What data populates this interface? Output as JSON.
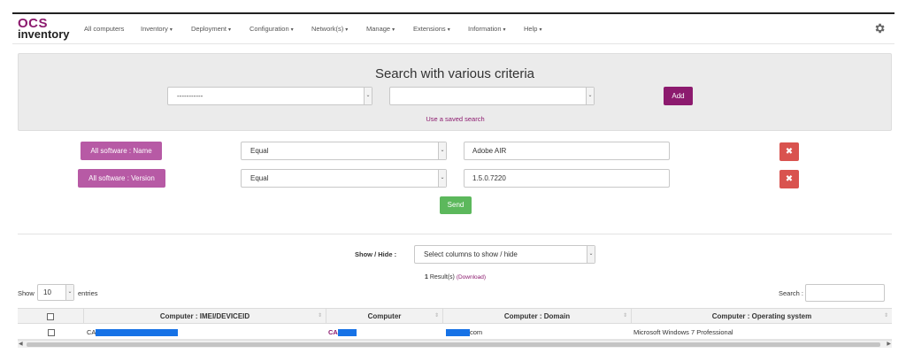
{
  "brand": {
    "logo_top": "OCS",
    "logo_bottom": "inventory",
    "accent": "#8c1a6e"
  },
  "nav": {
    "items": [
      {
        "label": "All computers",
        "dropdown": false
      },
      {
        "label": "Inventory",
        "dropdown": true
      },
      {
        "label": "Deployment",
        "dropdown": true
      },
      {
        "label": "Configuration",
        "dropdown": true
      },
      {
        "label": "Network(s)",
        "dropdown": true
      },
      {
        "label": "Manage",
        "dropdown": true
      },
      {
        "label": "Extensions",
        "dropdown": true
      },
      {
        "label": "Information",
        "dropdown": true
      },
      {
        "label": "Help",
        "dropdown": true
      }
    ],
    "settings_icon": "gear-icon"
  },
  "search": {
    "title": "Search with various criteria",
    "field_select_value": "-----------",
    "second_select_value": "",
    "add_label": "Add",
    "saved_search_link": "Use a saved search"
  },
  "criteria": [
    {
      "label": "All software : Name",
      "operator": "Equal",
      "value": "Adobe AIR"
    },
    {
      "label": "All software : Version",
      "operator": "Equal",
      "value": "1.5.0.7220"
    }
  ],
  "send_label": "Send",
  "showhide": {
    "label": "Show / Hide :",
    "select_value": "Select columns to show / hide"
  },
  "results": {
    "count": "1",
    "label": "Result(s)",
    "download": "(Download)"
  },
  "table_controls": {
    "show_label": "Show",
    "entries_value": "10",
    "entries_label": "entries",
    "search_label": "Search :"
  },
  "table": {
    "columns": [
      "Computer : IMEI/DEVICEID",
      "Computer",
      "Computer : Domain",
      "Computer : Operating system"
    ],
    "rows": [
      {
        "imei_prefix": "CA",
        "computer_prefix": "CA",
        "domain_suffix": "com",
        "os": "Microsoft Windows 7 Professional"
      }
    ]
  },
  "colors": {
    "criteria_label": "#b75aa5",
    "delete": "#d9534f",
    "send": "#5cb85c",
    "redaction": "#1672e6"
  }
}
